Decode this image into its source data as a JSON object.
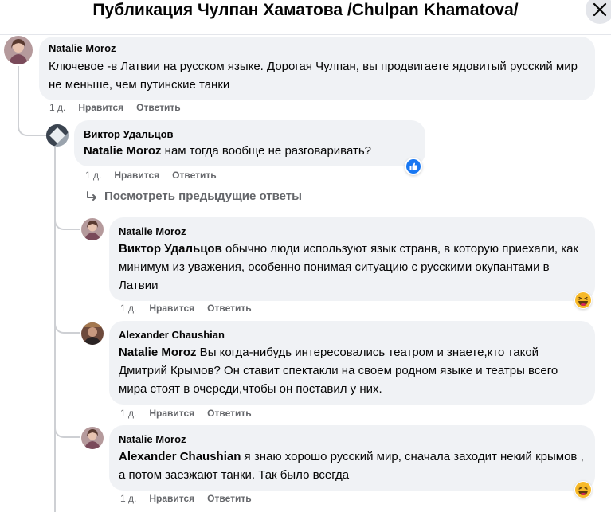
{
  "header": {
    "title": "Публикация Чулпан Хаматова /Chulpan Khamatova/",
    "close_icon": "close-icon"
  },
  "colors": {
    "bubble": "#f0f2f5",
    "meta_text": "#65676b",
    "thread_line": "#ced0d4",
    "like_blue": "#1877f2",
    "haha_yellow": "#f7b928"
  },
  "comments": [
    {
      "author": "Natalie Moroz",
      "mention": "",
      "text": "Ключевое -в Латвии на русском языке. Дорогая Чулпан, вы продвигаете ядовитый русский мир не меньше, чем путинские танки",
      "time": "1 д.",
      "like": "Нравится",
      "reply": "Ответить"
    },
    {
      "author": "Виктор Удальцов",
      "mention": "Natalie Moroz",
      "text": " нам тогда вообще не разговаривать?",
      "time": "1 д.",
      "like": "Нравится",
      "reply": "Ответить",
      "reaction": "like-icon"
    },
    {
      "author": "Natalie Moroz",
      "mention": "Виктор Удальцов",
      "text": " обычно люди используют язык странв, в которую приехали, как минимум из уважения, особенно понимая ситуацию с русскими окупантами в Латвии",
      "time": "1 д.",
      "like": "Нравится",
      "reply": "Ответить",
      "reaction": "haha-icon"
    },
    {
      "author": "Alexander Chaushian",
      "mention": "Natalie Moroz",
      "text": " Вы когда-нибудь интересовались театром и знаете,кто такой Дмитрий Крымов? Он ставит спектакли на своем родном языке и театры всего мира стоят в очереди,чтобы он поставил у них.",
      "time": "1 д.",
      "like": "Нравится",
      "reply": "Ответить"
    },
    {
      "author": "Natalie Moroz",
      "mention": "Alexander Chaushian",
      "text": " я знаю хорошо русский мир, сначала заходит некий крымов , а потом заезжают танки. Так было всегда",
      "time": "1 д.",
      "like": "Нравится",
      "reply": "Ответить",
      "reaction": "haha-icon"
    }
  ],
  "view_previous": "Посмотреть предыдущие ответы"
}
